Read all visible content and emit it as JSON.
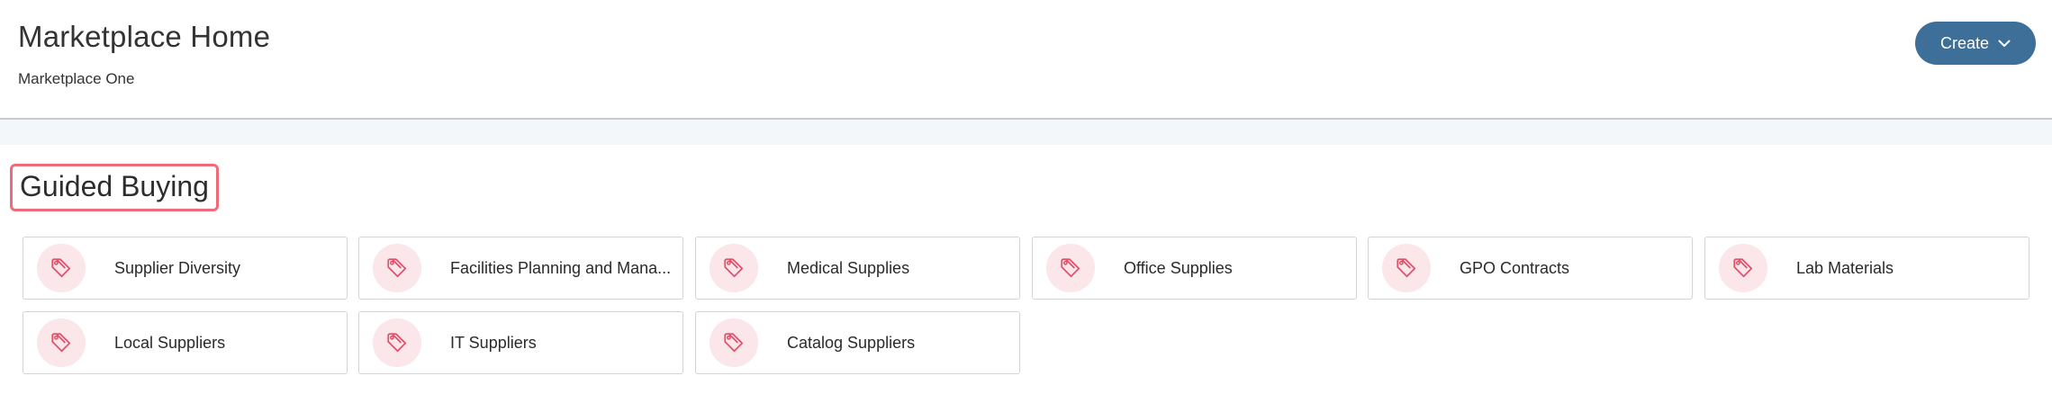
{
  "header": {
    "title": "Marketplace Home",
    "subtitle": "Marketplace One",
    "create_label": "Create",
    "create_icon": "chevron-down-icon",
    "accent_color": "#3d6f99"
  },
  "guided_buying": {
    "title": "Guided Buying",
    "highlight_color": "#ef6b7b",
    "tile_icon": "tag-icon",
    "tiles": [
      {
        "label": "Supplier Diversity"
      },
      {
        "label": "Facilities Planning and Mana..."
      },
      {
        "label": "Medical Supplies"
      },
      {
        "label": "Office Supplies"
      },
      {
        "label": "GPO Contracts"
      },
      {
        "label": "Lab Materials"
      },
      {
        "label": "Local Suppliers"
      },
      {
        "label": "IT Suppliers"
      },
      {
        "label": "Catalog Suppliers"
      }
    ]
  }
}
